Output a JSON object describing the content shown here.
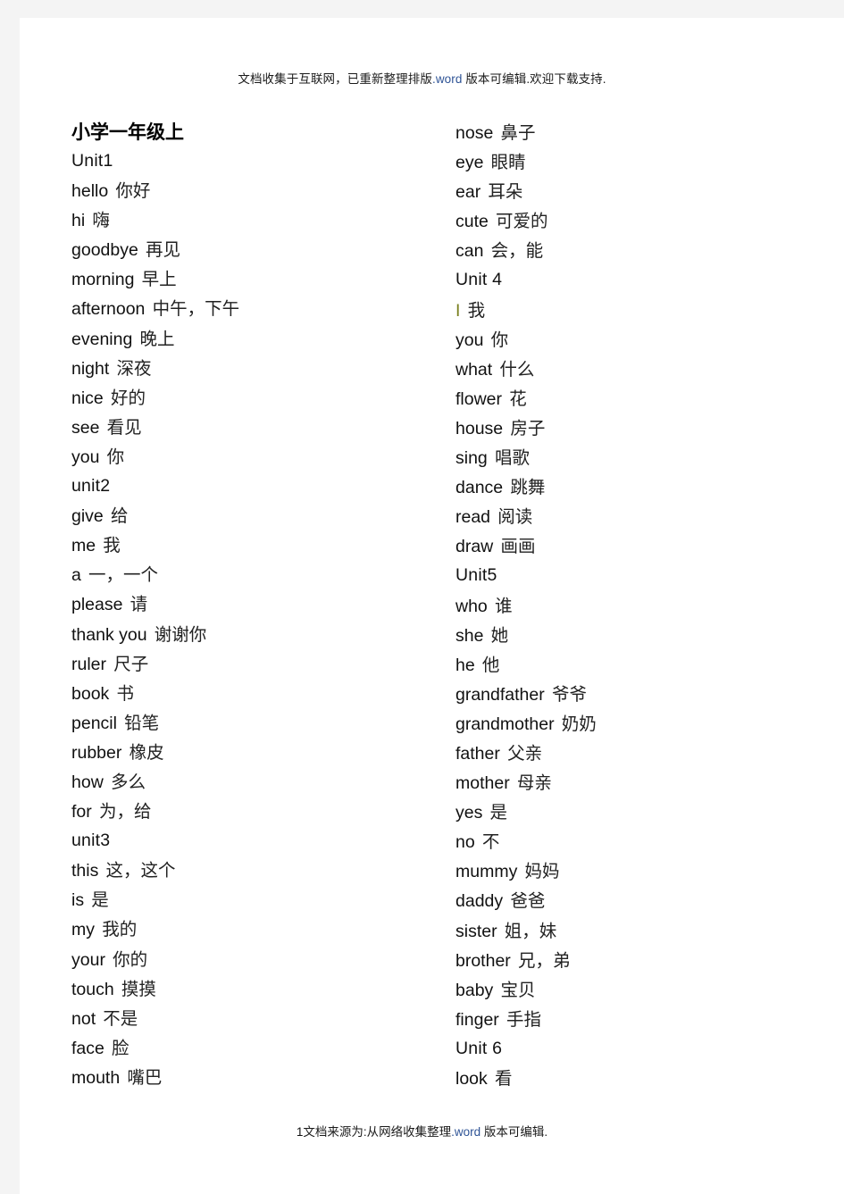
{
  "header": {
    "text_before": "文档收集于互联网，已重新整理排版",
    "accent": ".word",
    "text_after": " 版本可编辑.欢迎下载支持."
  },
  "footer": {
    "page_number": "1",
    "text_before": "文档来源为:从网络收集整理",
    "accent": ".word",
    "text_after": " 版本可编辑."
  },
  "document": {
    "title": "小学一年级上"
  },
  "left_column": [
    {
      "term": "Unit1",
      "gloss": "",
      "type": "unit"
    },
    {
      "term": "hello",
      "gloss": "你好",
      "type": "word"
    },
    {
      "term": "hi",
      "gloss": "嗨",
      "type": "word"
    },
    {
      "term": "goodbye",
      "gloss": "再见",
      "type": "word"
    },
    {
      "term": "morning",
      "gloss": "早上",
      "type": "word"
    },
    {
      "term": "afternoon",
      "gloss": "中午，下午",
      "type": "word"
    },
    {
      "term": "evening",
      "gloss": "晚上",
      "type": "word"
    },
    {
      "term": "night",
      "gloss": "深夜",
      "type": "word"
    },
    {
      "term": "nice",
      "gloss": "好的",
      "type": "word"
    },
    {
      "term": "see",
      "gloss": "看见",
      "type": "word"
    },
    {
      "term": "you",
      "gloss": "你",
      "type": "word"
    },
    {
      "term": "unit2",
      "gloss": "",
      "type": "unit"
    },
    {
      "term": "give",
      "gloss": "给",
      "type": "word"
    },
    {
      "term": "me",
      "gloss": "我",
      "type": "word"
    },
    {
      "term": "a",
      "gloss": "一，一个",
      "type": "word"
    },
    {
      "term": "please",
      "gloss": "请",
      "type": "word"
    },
    {
      "term": "thank you",
      "gloss": "谢谢你",
      "type": "word"
    },
    {
      "term": "ruler",
      "gloss": "尺子",
      "type": "word"
    },
    {
      "term": "book",
      "gloss": "书",
      "type": "word"
    },
    {
      "term": "pencil",
      "gloss": "铅笔",
      "type": "word"
    },
    {
      "term": "rubber",
      "gloss": "橡皮",
      "type": "word"
    },
    {
      "term": "how",
      "gloss": "多么",
      "type": "word"
    },
    {
      "term": "for",
      "gloss": "为，给",
      "type": "word"
    },
    {
      "term": "unit3",
      "gloss": "",
      "type": "unit"
    },
    {
      "term": "this",
      "gloss": "这，这个",
      "type": "word"
    },
    {
      "term": "is",
      "gloss": "是",
      "type": "word"
    },
    {
      "term": "my",
      "gloss": "我的",
      "type": "word"
    },
    {
      "term": "your",
      "gloss": "你的",
      "type": "word"
    },
    {
      "term": "touch",
      "gloss": "摸摸",
      "type": "word"
    },
    {
      "term": "not",
      "gloss": "不是",
      "type": "word"
    },
    {
      "term": "face",
      "gloss": "脸",
      "type": "word"
    },
    {
      "term": "mouth",
      "gloss": "嘴巴",
      "type": "word"
    }
  ],
  "right_column": [
    {
      "term": "nose",
      "gloss": "鼻子",
      "type": "word"
    },
    {
      "term": "eye",
      "gloss": "眼睛",
      "type": "word"
    },
    {
      "term": "ear",
      "gloss": "耳朵",
      "type": "word"
    },
    {
      "term": "cute",
      "gloss": "可爱的",
      "type": "word"
    },
    {
      "term": "can",
      "gloss": "会，能",
      "type": "word"
    },
    {
      "term": "Unit 4",
      "gloss": "",
      "type": "unit"
    },
    {
      "term": "I",
      "gloss": "我",
      "type": "marked"
    },
    {
      "term": "you",
      "gloss": "你",
      "type": "word"
    },
    {
      "term": "what",
      "gloss": "什么",
      "type": "word"
    },
    {
      "term": "flower",
      "gloss": "花",
      "type": "word"
    },
    {
      "term": "house",
      "gloss": "房子",
      "type": "word"
    },
    {
      "term": "sing",
      "gloss": "唱歌",
      "type": "word"
    },
    {
      "term": "dance",
      "gloss": "跳舞",
      "type": "word"
    },
    {
      "term": "read",
      "gloss": "阅读",
      "type": "word"
    },
    {
      "term": "draw",
      "gloss": "画画",
      "type": "word"
    },
    {
      "term": "Unit5",
      "gloss": "",
      "type": "unit"
    },
    {
      "term": "who",
      "gloss": "谁",
      "type": "word"
    },
    {
      "term": "she",
      "gloss": "她",
      "type": "word"
    },
    {
      "term": "he",
      "gloss": "他",
      "type": "word"
    },
    {
      "term": "grandfather",
      "gloss": "爷爷",
      "type": "word"
    },
    {
      "term": "grandmother",
      "gloss": "奶奶",
      "type": "word"
    },
    {
      "term": "father",
      "gloss": "父亲",
      "type": "word"
    },
    {
      "term": "mother",
      "gloss": "母亲",
      "type": "word"
    },
    {
      "term": "yes",
      "gloss": "是",
      "type": "word"
    },
    {
      "term": "no",
      "gloss": "不",
      "type": "word"
    },
    {
      "term": "mummy",
      "gloss": "妈妈",
      "type": "word"
    },
    {
      "term": "daddy",
      "gloss": "爸爸",
      "type": "word"
    },
    {
      "term": "sister",
      "gloss": "姐，妹",
      "type": "word"
    },
    {
      "term": "brother",
      "gloss": "兄，弟",
      "type": "word"
    },
    {
      "term": "baby",
      "gloss": "宝贝",
      "type": "word"
    },
    {
      "term": "finger",
      "gloss": "手指",
      "type": "word"
    },
    {
      "term": "Unit 6",
      "gloss": "",
      "type": "unit"
    },
    {
      "term": "look",
      "gloss": "看",
      "type": "word"
    }
  ]
}
